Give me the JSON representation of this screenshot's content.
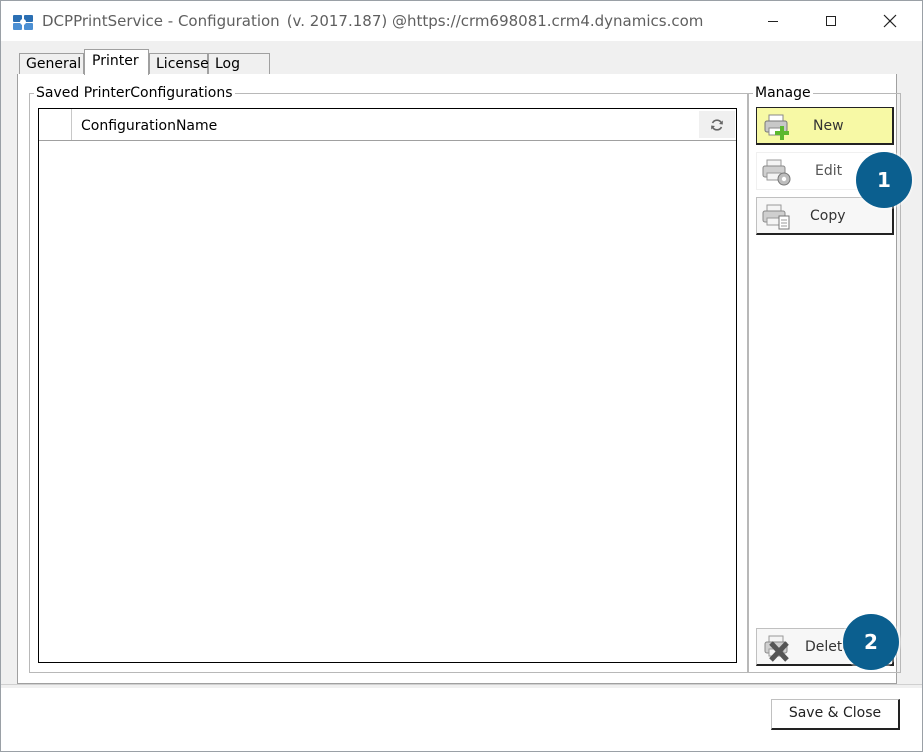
{
  "window": {
    "title_app": "DCPPrintService - Configuration",
    "title_version": "(v. 2017.187)",
    "title_url": "@https://crm698081.crm4.dynamics.com"
  },
  "tabs": [
    {
      "label": "General"
    },
    {
      "label": "Printer"
    },
    {
      "label": "License"
    },
    {
      "label": "Log"
    }
  ],
  "saved_configs": {
    "legend": "Saved PrinterConfigurations",
    "columns": [
      "ConfigurationName"
    ],
    "rows": []
  },
  "manage": {
    "legend": "Manage",
    "new_label": "New",
    "edit_label": "Edit",
    "copy_label": "Copy",
    "delete_label": "Delete"
  },
  "callouts": {
    "one": "1",
    "two": "2",
    "color": "#0b5f8f"
  },
  "footer": {
    "save_close_label": "Save & Close"
  },
  "colors": {
    "new_button_bg": "#f7f9a5"
  }
}
